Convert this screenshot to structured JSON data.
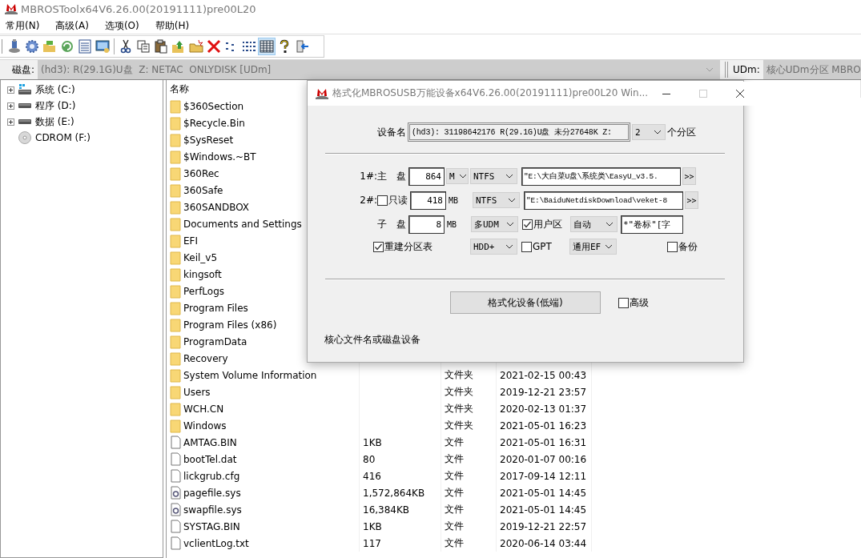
{
  "window": {
    "title": "MBROSToolx64V6.26.00(20191111)pre00L20"
  },
  "menu": [
    "常用(N)",
    "高级(A)",
    "选项(O)",
    "帮助(H)"
  ],
  "toolbar": [
    {
      "kind": "usb",
      "selected": false
    },
    {
      "kind": "gear",
      "selected": false
    },
    {
      "kind": "open",
      "selected": false
    },
    {
      "kind": "refresh",
      "selected": false
    },
    {
      "kind": "list",
      "selected": false
    },
    {
      "kind": "monitor",
      "selected": false
    },
    {
      "kind": "sep"
    },
    {
      "kind": "cut",
      "selected": false
    },
    {
      "kind": "copy",
      "selected": false
    },
    {
      "kind": "paste",
      "selected": false
    },
    {
      "kind": "up",
      "selected": false
    },
    {
      "kind": "newfolder",
      "selected": false
    },
    {
      "kind": "delete",
      "selected": false
    },
    {
      "kind": "smallicons",
      "selected": false
    },
    {
      "kind": "listview",
      "selected": false
    },
    {
      "kind": "details",
      "selected": true
    },
    {
      "kind": "help",
      "selected": false
    },
    {
      "kind": "exit",
      "selected": false
    }
  ],
  "disk_bar": {
    "label": "磁盘:",
    "value": "(hd3): R(29.1G)U盘  Z: NETAC  ONLYDISK [UDm]"
  },
  "udm_bar": {
    "label": "UDm:",
    "value": "核心UDm分区 MBRO"
  },
  "tree": [
    {
      "label": "系统 (C:)",
      "kind": "system",
      "expanded": false
    },
    {
      "label": "程序 (D:)",
      "kind": "drive",
      "expanded": false
    },
    {
      "label": "数据 (E:)",
      "kind": "drive",
      "expanded": false
    },
    {
      "label": "CDROM (F:)",
      "kind": "cdrom"
    }
  ],
  "file_list": {
    "columns": [
      "名称"
    ],
    "rows": [
      {
        "name": "$360Section",
        "kind": "folder"
      },
      {
        "name": "$Recycle.Bin",
        "kind": "folder"
      },
      {
        "name": "$SysReset",
        "kind": "folder"
      },
      {
        "name": "$Windows.~BT",
        "kind": "folder"
      },
      {
        "name": "360Rec",
        "kind": "folder"
      },
      {
        "name": "360Safe",
        "kind": "folder"
      },
      {
        "name": "360SANDBOX",
        "kind": "folder"
      },
      {
        "name": "Documents and Settings",
        "kind": "folder"
      },
      {
        "name": "EFI",
        "kind": "folder"
      },
      {
        "name": "Keil_v5",
        "kind": "folder"
      },
      {
        "name": "kingsoft",
        "kind": "folder"
      },
      {
        "name": "PerfLogs",
        "kind": "folder"
      },
      {
        "name": "Program Files",
        "kind": "folder"
      },
      {
        "name": "Program Files (x86)",
        "kind": "folder"
      },
      {
        "name": "ProgramData",
        "kind": "folder"
      },
      {
        "name": "Recovery",
        "kind": "folder"
      },
      {
        "name": "System Volume Information",
        "kind": "folder",
        "type": "文件夹",
        "modified": "2021-02-15 00:43"
      },
      {
        "name": "Users",
        "kind": "folder",
        "type": "文件夹",
        "modified": "2019-12-21 23:57"
      },
      {
        "name": "WCH.CN",
        "kind": "folder",
        "type": "文件夹",
        "modified": "2020-02-13 01:37"
      },
      {
        "name": "Windows",
        "kind": "folder",
        "type": "文件夹",
        "modified": "2021-05-01 16:23"
      },
      {
        "name": "AMTAG.BIN",
        "kind": "file",
        "size": "1KB",
        "type": "文件",
        "modified": "2021-05-01 16:31"
      },
      {
        "name": "bootTel.dat",
        "kind": "file",
        "size": "80",
        "type": "文件",
        "modified": "2020-01-07 00:16"
      },
      {
        "name": "lickgrub.cfg",
        "kind": "file",
        "size": "416",
        "type": "文件",
        "modified": "2017-09-14 12:11"
      },
      {
        "name": "pagefile.sys",
        "kind": "system",
        "size": "1,572,864KB",
        "type": "文件",
        "modified": "2021-05-01 14:45"
      },
      {
        "name": "swapfile.sys",
        "kind": "system",
        "size": "16,384KB",
        "type": "文件",
        "modified": "2021-05-01 14:45"
      },
      {
        "name": "SYSTAG.BIN",
        "kind": "file",
        "size": "1KB",
        "type": "文件",
        "modified": "2019-12-21 22:57"
      },
      {
        "name": "vclientLog.txt",
        "kind": "file",
        "size": "117",
        "type": "文件",
        "modified": "2020-06-14 03:44"
      }
    ]
  },
  "dialog": {
    "title": "格式化MBROSUSB万能设备x64V6.26.00(20191111)pre00L20 Win...",
    "device": {
      "label": "设备名",
      "value": "(hd3): 31198642176 R(29.1G)U盘 未分27648K Z:",
      "partitions": "2",
      "suffix": "个分区"
    },
    "partition_1": {
      "label": "1#:主　盘",
      "size": "864",
      "unit": "M",
      "filesystem": "NTFS",
      "source": "\"E:\\大白菜U盘\\系统类\\EasyU_v3.5.",
      "browse": ">>"
    },
    "partition_2": {
      "prefix": "2#:",
      "readonly": {
        "label": "只读",
        "checked": false
      },
      "size": "418",
      "unit": "MB",
      "filesystem": "NTFS",
      "source": "\"E:\\BaiduNetdiskDownload\\veket-8",
      "browse": ">>"
    },
    "sub_disk": {
      "label": "子　盘",
      "size": "8",
      "unit": "MB",
      "mode": "多UDM",
      "user_area": {
        "label": "用户区",
        "checked": true
      },
      "auto": "自动",
      "volume": "*\"卷标\"[字"
    },
    "options": {
      "rebuild": {
        "label": "重建分区表",
        "checked": true
      },
      "disk_type": "HDD+",
      "gpt": {
        "label": "GPT",
        "checked": false
      },
      "boot": "通用EF",
      "backup": {
        "label": "备份",
        "checked": false
      }
    },
    "format_button": "格式化设备(低端)",
    "advanced": {
      "label": "高级",
      "checked": false
    },
    "status": "核心文件名或磁盘设备"
  }
}
